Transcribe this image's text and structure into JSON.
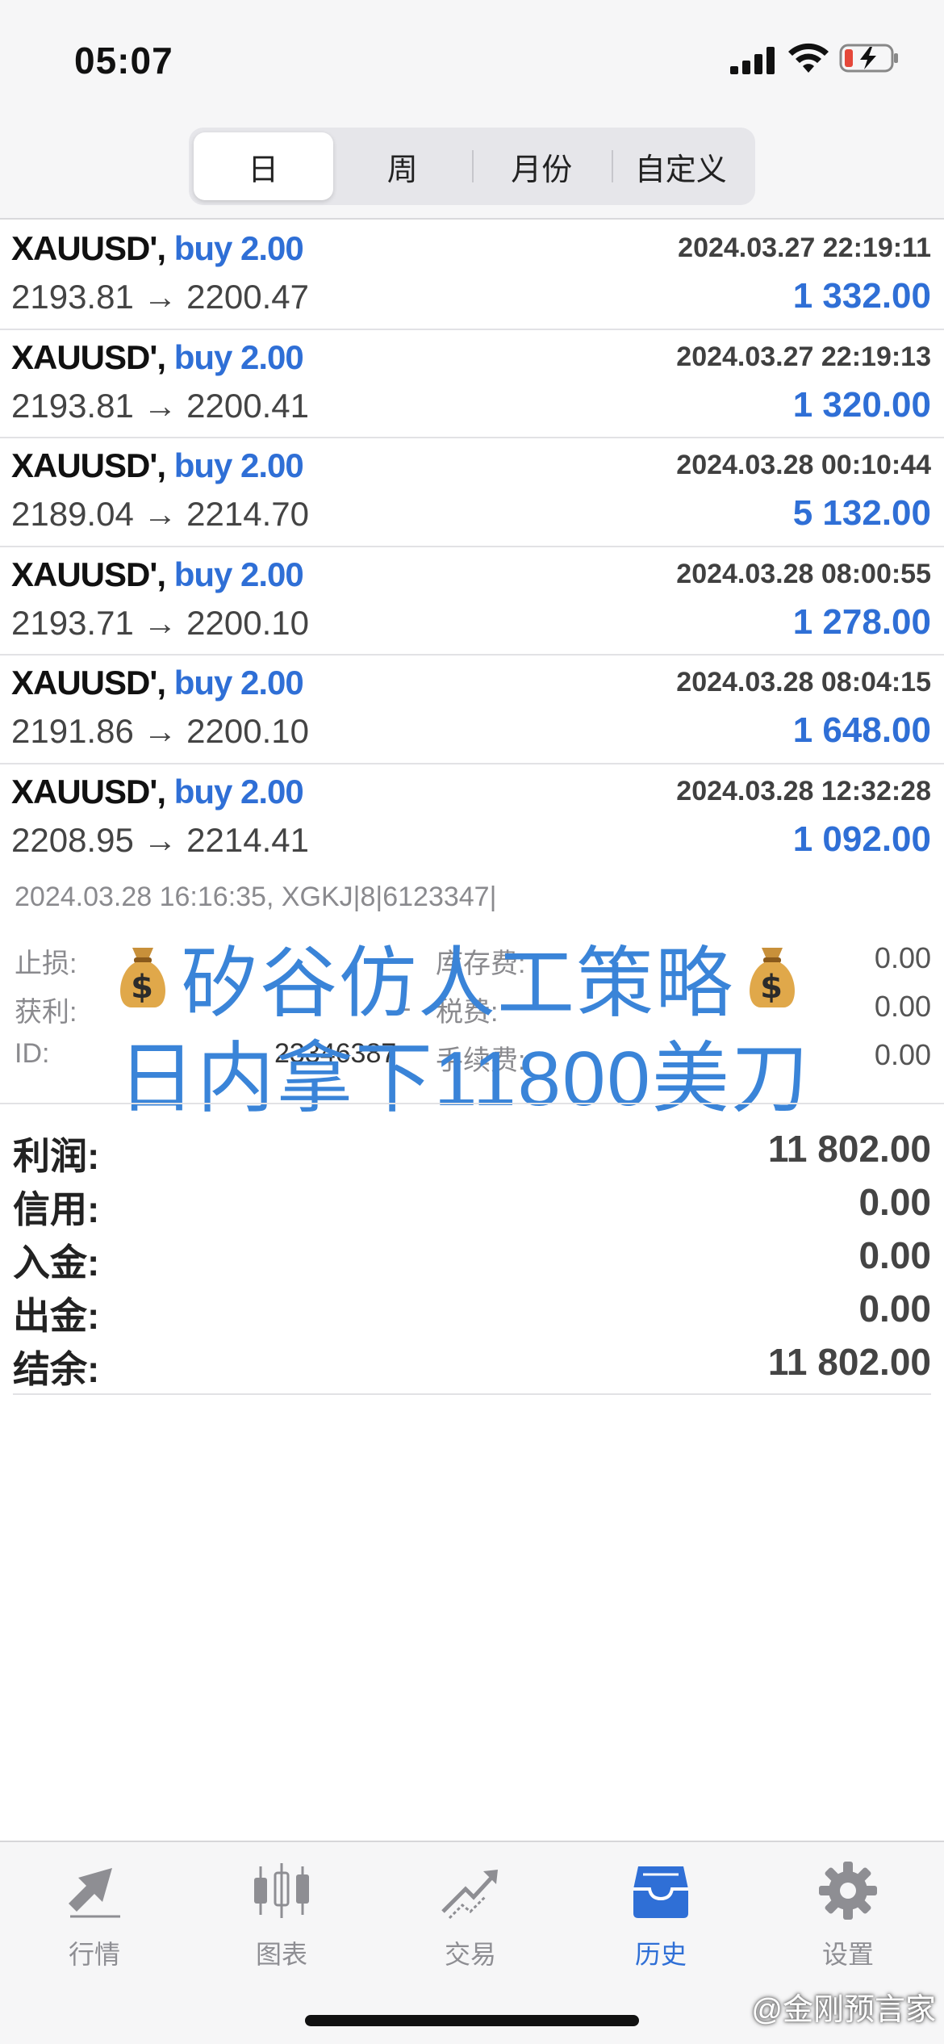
{
  "status_bar": {
    "time": "05:07"
  },
  "segments": [
    "日",
    "周",
    "月份",
    "自定义"
  ],
  "active_segment": "日",
  "deals": [
    {
      "symbol": "XAUUSD',",
      "direction": "buy 2.00",
      "datetime": "2024.03.27 22:19:11",
      "prices": "2193.81 → 2200.47",
      "profit": "1 332.00"
    },
    {
      "symbol": "XAUUSD',",
      "direction": "buy 2.00",
      "datetime": "2024.03.27 22:19:13",
      "prices": "2193.81 → 2200.41",
      "profit": "1 320.00"
    },
    {
      "symbol": "XAUUSD',",
      "direction": "buy 2.00",
      "datetime": "2024.03.28 00:10:44",
      "prices": "2189.04 → 2214.70",
      "profit": "5 132.00"
    },
    {
      "symbol": "XAUUSD',",
      "direction": "buy 2.00",
      "datetime": "2024.03.28 08:00:55",
      "prices": "2193.71 → 2200.10",
      "profit": "1 278.00"
    },
    {
      "symbol": "XAUUSD',",
      "direction": "buy 2.00",
      "datetime": "2024.03.28 08:04:15",
      "prices": "2191.86 → 2200.10",
      "profit": "1 648.00"
    },
    {
      "symbol": "XAUUSD',",
      "direction": "buy 2.00",
      "datetime": "2024.03.28 12:32:28",
      "prices": "2208.95 → 2214.41",
      "profit": "1 092.00"
    }
  ],
  "detail": {
    "header": "2024.03.28 16:16:35, XGKJ|8|6123347|",
    "stop_loss_label": "止损:",
    "stop_loss_value": "-",
    "take_profit_label": "获利:",
    "take_profit_value": "-",
    "id_label": "ID:",
    "id_value": "23346387",
    "swap_label": "库存费:",
    "swap_value": "0.00",
    "tax_label": "税费:",
    "tax_value": "0.00",
    "commission_label": "手续费:",
    "commission_value": "0.00"
  },
  "overlay": {
    "line1": "矽谷仿人工策略",
    "line2": "日内拿下11800美刀",
    "icon": "money-bag-icon"
  },
  "summary": [
    {
      "label": "利润:",
      "value": "11 802.00"
    },
    {
      "label": "信用:",
      "value": "0.00"
    },
    {
      "label": "入金:",
      "value": "0.00"
    },
    {
      "label": "出金:",
      "value": "0.00"
    },
    {
      "label": "结余:",
      "value": "11 802.00"
    }
  ],
  "tabs": [
    {
      "label": "行情",
      "icon": "quotes-icon"
    },
    {
      "label": "图表",
      "icon": "candlestick-chart-icon"
    },
    {
      "label": "交易",
      "icon": "trade-icon"
    },
    {
      "label": "历史",
      "icon": "history-icon"
    },
    {
      "label": "设置",
      "icon": "gear-icon"
    }
  ],
  "active_tab": "历史",
  "watermark": "@金刚预言家",
  "colors": {
    "accent": "#2f6fd6",
    "overlay_text": "#3a84d8",
    "muted": "#8a8a8e"
  }
}
